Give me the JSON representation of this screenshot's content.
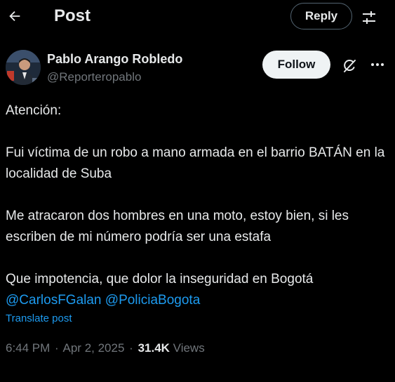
{
  "header": {
    "title": "Post",
    "reply_label": "Reply",
    "back_icon": "arrow-left-icon",
    "filter_icon": "sliders-icon"
  },
  "author": {
    "name": "Pablo Arango Robledo",
    "handle": "@Reporteropablo",
    "follow_label": "Follow",
    "grok_icon": "grok-icon",
    "more_icon": "more-horizontal-icon"
  },
  "post": {
    "line1": "Atención:",
    "line2": "Fui víctima de un robo a mano armada en el barrio BATÁN en la localidad de Suba",
    "line3": "Me atracaron dos hombres en una moto, estoy bien, si les escriben de mi número podría ser una estafa",
    "line4": "Que impotencia, que dolor la inseguridad en Bogotá",
    "mentions": [
      "@CarlosFGalan",
      "@PoliciaBogota"
    ],
    "translate_label": "Translate post"
  },
  "meta": {
    "time": "6:44 PM",
    "date": "Apr 2, 2025",
    "separator": "·",
    "views_count": "31.4K",
    "views_label": "Views"
  },
  "colors": {
    "background": "#000000",
    "text": "#e7e9ea",
    "muted": "#71767b",
    "link": "#1d9bf0",
    "follow_bg": "#eff3f4"
  }
}
